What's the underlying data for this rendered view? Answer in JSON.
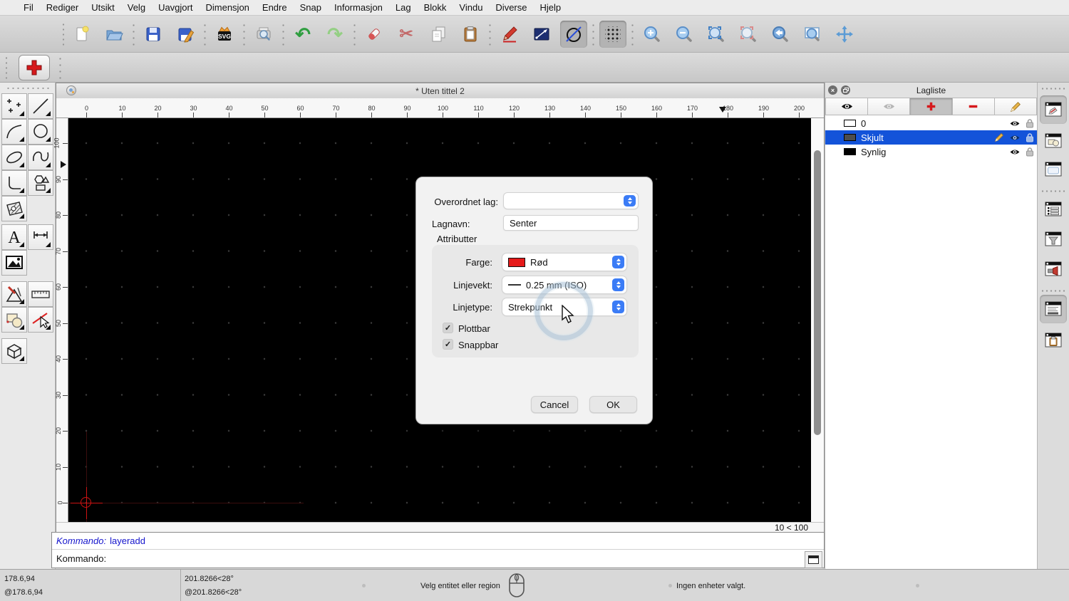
{
  "menu": {
    "items": [
      "Fil",
      "Rediger",
      "Utsikt",
      "Velg",
      "Uavgjort",
      "Dimensjon",
      "Endre",
      "Snap",
      "Informasjon",
      "Lag",
      "Blokk",
      "Vindu",
      "Diverse",
      "Hjelp"
    ]
  },
  "glyphs": {
    "check": "✓",
    "undo": "↶",
    "redo": "↷",
    "scissors": "✂",
    "close": "×",
    "text_tool": "A"
  },
  "toolbar": {
    "svg_badge": "SVG",
    "buttons_row1": [
      "new-file",
      "open-file",
      "save",
      "save-as",
      "export-svg",
      "print-preview",
      "undo",
      "redo",
      "delete",
      "cut",
      "copy",
      "paste",
      "draw-pencil",
      "line-preview",
      "circle-line-toggle",
      "grid-toggle",
      "zoom-in",
      "zoom-out",
      "zoom-auto",
      "zoom-previous",
      "zoom-back",
      "zoom-window",
      "zoom-pan"
    ],
    "buttons_row2": [
      "add-layer"
    ]
  },
  "document": {
    "title": "* Uten tittel 2",
    "grid_status": "10 < 100"
  },
  "rulers": {
    "h_ticks": [
      0,
      10,
      20,
      30,
      40,
      50,
      60,
      70,
      80,
      90,
      100,
      110,
      120,
      130,
      140,
      150,
      160,
      170,
      180,
      190,
      200
    ],
    "v_ticks": [
      0,
      10,
      20,
      30,
      40,
      50,
      60,
      70,
      80,
      90,
      100
    ],
    "h_marker_value": 178.6,
    "v_marker_value": 94
  },
  "dialog": {
    "parent_label": "Overordnet lag:",
    "name_label": "Lagnavn:",
    "name_value": "Senter",
    "attributes_label": "Attributter",
    "color_label": "Farge:",
    "color_value": "Rød",
    "lineweight_label": "Linjevekt:",
    "lineweight_value": "0.25 mm (ISO)",
    "linetype_label": "Linjetype:",
    "linetype_value": "Strekpunkt",
    "plottable_label": "Plottbar",
    "plottable_checked": true,
    "snappable_label": "Snappbar",
    "snappable_checked": true,
    "cancel_label": "Cancel",
    "ok_label": "OK"
  },
  "layer_panel": {
    "title": "Lagliste",
    "layers": [
      {
        "name": "0",
        "color": "#ffffff",
        "selected": false
      },
      {
        "name": "Skjult",
        "color": "#4d4d4d",
        "selected": true
      },
      {
        "name": "Synlig",
        "color": "#000000",
        "selected": false
      }
    ]
  },
  "command": {
    "history_label": "Kommando:",
    "history_value": "layeradd",
    "input_label": "Kommando:"
  },
  "status_bar": {
    "abs_coord": "178.6,94",
    "rel_coord": "@178.6,94",
    "abs_polar": "201.8266<28°",
    "rel_polar": "@201.8266<28°",
    "hint": "Velg entitet eller region",
    "selection_status": "Ingen enheter valgt."
  },
  "colors": {
    "selection_blue": "#1353d9",
    "accent_red": "#d6191c",
    "stepper_blue": "#3b7cf6",
    "canvas_black": "#000000"
  }
}
